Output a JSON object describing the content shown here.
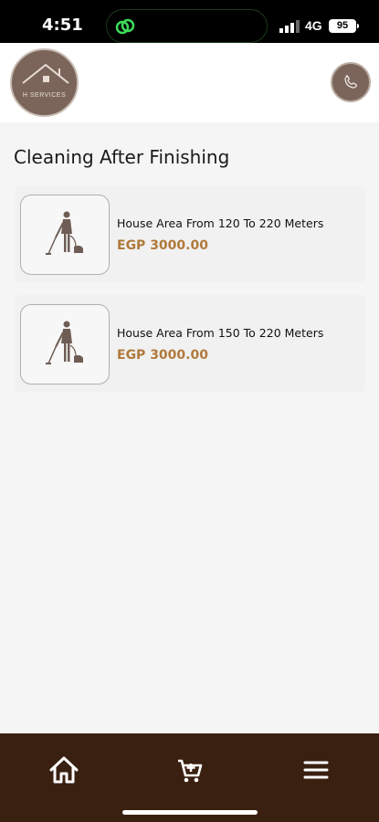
{
  "status_bar": {
    "time": "4:51",
    "network": "4G",
    "battery": "95"
  },
  "header": {
    "logo_text": "H SERVICES",
    "logo_icon": "house-icon",
    "phone_icon": "phone-icon"
  },
  "page": {
    "title": "Cleaning After Finishing"
  },
  "products": [
    {
      "title": "House Area From 120 To 220 Meters",
      "price": "EGP 3000.00",
      "icon": "cleaner-icon"
    },
    {
      "title": "House Area From 150 To 220 Meters",
      "price": "EGP 3000.00",
      "icon": "cleaner-icon"
    }
  ],
  "bottom_nav": {
    "home_icon": "home-icon",
    "cart_icon": "cart-icon",
    "menu_icon": "menu-icon"
  },
  "colors": {
    "brand": "#7b655a",
    "price": "#b07a3c",
    "nav_bg": "#3a2011"
  }
}
